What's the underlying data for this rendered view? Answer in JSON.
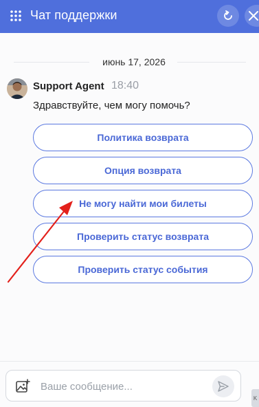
{
  "header": {
    "title": "Чат поддержки",
    "menu_icon": "grid-icon",
    "refresh_icon": "refresh-icon",
    "close_icon": "close-icon",
    "color": "#4f6fdc"
  },
  "conversation": {
    "date": "июнь 17, 2026",
    "agent": {
      "name": "Support Agent",
      "time": "18:40",
      "avatar_icon": "avatar"
    },
    "greeting": "Здравствуйте, чем могу помочь?",
    "options": [
      "Политика возврата",
      "Опция возврата",
      "Не могу найти мои билеты",
      "Проверить статус возврата",
      "Проверить статус события"
    ],
    "option_color": "#4a68d6"
  },
  "composer": {
    "placeholder": "Ваше сообщение...",
    "attach_icon": "image-upload-icon",
    "send_icon": "send-icon"
  },
  "side_tab": {
    "label": "K"
  },
  "annotation": {
    "arrow_color": "#e3201b"
  }
}
